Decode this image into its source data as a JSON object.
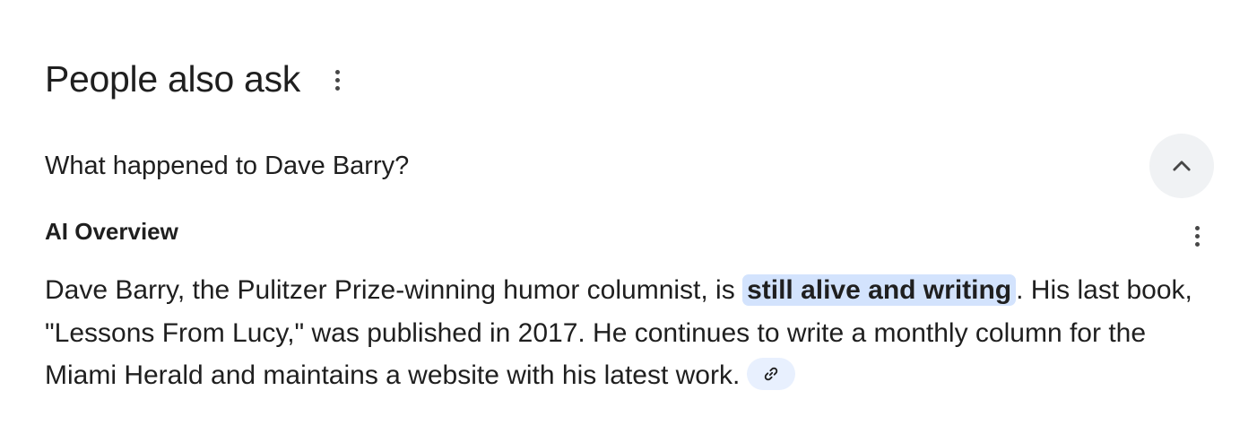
{
  "header": {
    "title": "People also ask"
  },
  "question": {
    "text": "What happened to Dave Barry?"
  },
  "ai_overview": {
    "label": "AI Overview",
    "answer": {
      "before": "Dave Barry, the Pulitzer Prize-winning humor columnist, is ",
      "highlight": "still alive and writing",
      "after": ". His last book, \"Lessons From Lucy,\" was published in 2017. He continues to write a monthly column for the Miami Herald and maintains a website with his latest work."
    }
  },
  "icons": {
    "header_menu": "more-vert-icon",
    "collapse": "chevron-up-icon",
    "ai_menu": "more-vert-icon",
    "source_link": "link-icon"
  },
  "colors": {
    "highlight_bg": "#d3e3fd",
    "chip_bg": "#e8f0fe",
    "button_bg": "#f0f2f4",
    "text": "#1f1f1f"
  }
}
